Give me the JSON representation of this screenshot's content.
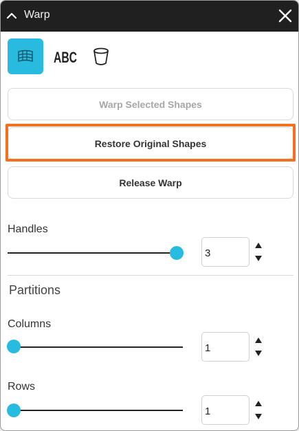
{
  "window": {
    "title": "Warp"
  },
  "tabs": [
    {
      "icon": "warp-grid-icon",
      "active": true
    },
    {
      "icon": "abc-text-icon",
      "active": false
    },
    {
      "icon": "cup-shape-icon",
      "active": false
    }
  ],
  "buttons": {
    "warp_selected": "Warp Selected Shapes",
    "restore_original": "Restore Original Shapes",
    "release_warp": "Release Warp"
  },
  "handles": {
    "label": "Handles",
    "value": "3",
    "slider_fraction": 1.0
  },
  "partitions": {
    "title": "Partitions",
    "columns": {
      "label": "Columns",
      "value": "1",
      "slider_fraction": 0.0
    },
    "rows": {
      "label": "Rows",
      "value": "1",
      "slider_fraction": 0.0
    }
  },
  "colors": {
    "accent": "#27bcdf",
    "highlight": "#f37021",
    "titlebar": "#202020"
  }
}
